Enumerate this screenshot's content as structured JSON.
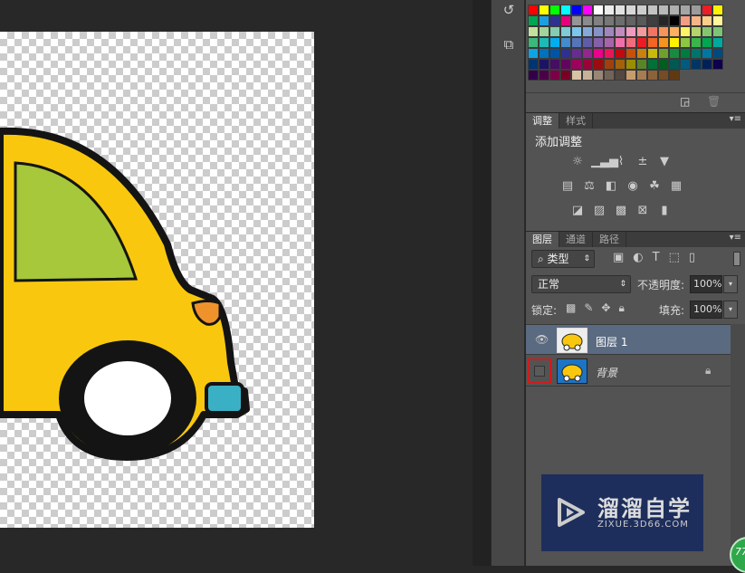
{
  "colors": {
    "car_body": "#f9c80e",
    "window": "#a6c83a",
    "outline": "#141414",
    "light": "#f0922c",
    "bumper": "#3ab0c4",
    "selected_layer": "#5a6a80",
    "highlight_box": "#d01c1c"
  },
  "swatches": [
    "#ff0000",
    "#ffff00",
    "#00ff00",
    "#00ffff",
    "#0000ff",
    "#ff00ff",
    "#ffffff",
    "#ebebeb",
    "#e1e1e1",
    "#d7d7d7",
    "#cdcdcd",
    "#c3c3c3",
    "#b9b9b9",
    "#afafaf",
    "#a5a5a5",
    "#9b9b9b",
    "#ee1c24",
    "#fff200",
    "#00a651",
    "#1c9fe0",
    "#2e3192",
    "#e6007e",
    "#959595",
    "#8b8b8b",
    "#818181",
    "#777777",
    "#6d6d6d",
    "#636363",
    "#595959",
    "#3f3f3f",
    "#262626",
    "#000000",
    "#f49d84",
    "#f7b488",
    "#fbcd8a",
    "#fff59b",
    "#c5e09d",
    "#a3d39c",
    "#86ccb0",
    "#7fccd6",
    "#7cc5ec",
    "#86a9dc",
    "#8693ca",
    "#a186be",
    "#c18bbe",
    "#f09ac0",
    "#f39a9c",
    "#f37462",
    "#f7945a",
    "#fbb15f",
    "#fff463",
    "#b5d56a",
    "#86c56f",
    "#7cc576",
    "#3cb878",
    "#1cbbb4",
    "#00aeef",
    "#448ccb",
    "#5674b9",
    "#605ca8",
    "#8560a8",
    "#a864a8",
    "#f06eaa",
    "#f26c7d",
    "#ed1c24",
    "#f26522",
    "#f7941d",
    "#fff200",
    "#8dc63f",
    "#39b54a",
    "#00a651",
    "#00a99d",
    "#0ea4e4",
    "#0072bc",
    "#0054a6",
    "#2e3192",
    "#662d91",
    "#92278f",
    "#ec008c",
    "#ed145b",
    "#c1090e",
    "#c75109",
    "#c98110",
    "#c9b90a",
    "#6ea02c",
    "#198b3e",
    "#007b40",
    "#00746b",
    "#0076a3",
    "#004a80",
    "#003471",
    "#1b1464",
    "#440e62",
    "#630460",
    "#9e005d",
    "#9e0039",
    "#9e0b0f",
    "#a0410d",
    "#a36209",
    "#998e00",
    "#598527",
    "#007236",
    "#005e20",
    "#005952",
    "#005b7f",
    "#003663",
    "#002157",
    "#0d004c",
    "#32004b",
    "#4b0049",
    "#7b0046",
    "#7a0026",
    "#d9c3a5",
    "#c7b299",
    "#998675",
    "#736357",
    "#534741",
    "#c69c6d",
    "#a67c52",
    "#8c6239",
    "#754c24",
    "#603913"
  ],
  "adjustments": {
    "tabs": [
      "调整",
      "样式"
    ],
    "title": "添加调整",
    "rows": [
      [
        "brightness-contrast-icon",
        "levels-icon",
        "curves-icon",
        "exposure-icon",
        "gradient-triangle-icon"
      ],
      [
        "vibrance-icon",
        "color-balance-icon",
        "black-white-icon",
        "photo-filter-icon",
        "channel-mixer-icon",
        "color-lookup-icon"
      ],
      [
        "invert-icon",
        "posterize-icon",
        "threshold-icon",
        "selective-color-icon",
        "gradient-map-icon"
      ]
    ]
  },
  "layers": {
    "tabs": [
      "图层",
      "通道",
      "路径"
    ],
    "filter_label": "类型",
    "blend_mode": "正常",
    "opacity_label": "不透明度:",
    "opacity": "100%",
    "lock_label": "锁定:",
    "fill_label": "填充:",
    "fill": "100%",
    "items": [
      {
        "name": "图层 1",
        "visible": true,
        "selected": true
      },
      {
        "name": "背景",
        "visible": false,
        "locked": true
      }
    ]
  },
  "watermark": {
    "title": "溜溜自学",
    "url": "ZIXUE.3D66.COM"
  },
  "badge": "77"
}
